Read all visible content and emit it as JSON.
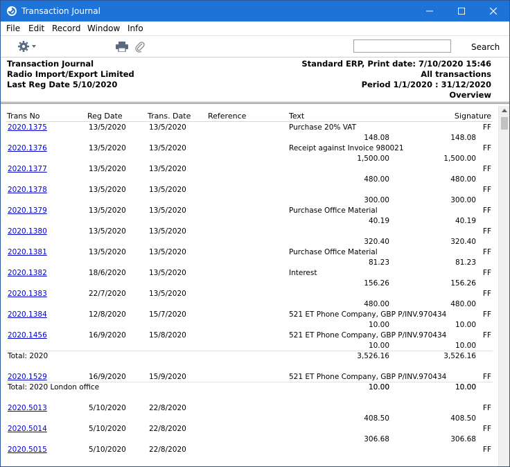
{
  "window": {
    "title": "Transaction Journal",
    "accent_color": "#1e73d8"
  },
  "menu": [
    "File",
    "Edit",
    "Record",
    "Window",
    "Info"
  ],
  "toolbar": {
    "search_label": "Search",
    "search_value": ""
  },
  "report": {
    "title": "Transaction Journal",
    "company": "Radio Import/Export Limited",
    "last_reg": "Last Reg Date  5/10/2020",
    "print_info": "Standard ERP, Print date: 7/10/2020 15:46",
    "selection": "All transactions",
    "period": "Period  1/1/2020 : 31/12/2020",
    "mode": "Overview"
  },
  "columns": {
    "trans_no": "Trans No",
    "reg_date": "Reg Date",
    "trans_date": "Trans. Date",
    "reference": "Reference",
    "text": "Text",
    "signature": "Signature"
  },
  "rows": [
    {
      "no": "2020.1375",
      "reg": "13/5/2020",
      "tdate": "13/5/2020",
      "text": "Purchase 20% VAT",
      "sig": "FF",
      "debit": "148.08",
      "credit": "148.08"
    },
    {
      "no": "2020.1376",
      "reg": "13/5/2020",
      "tdate": "13/5/2020",
      "text": "Receipt against Invoice 980021",
      "sig": "FF",
      "debit": "1,500.00",
      "credit": "1,500.00"
    },
    {
      "no": "2020.1377",
      "reg": "13/5/2020",
      "tdate": "13/5/2020",
      "text": "",
      "sig": "FF",
      "debit": "480.00",
      "credit": "480.00"
    },
    {
      "no": "2020.1378",
      "reg": "13/5/2020",
      "tdate": "13/5/2020",
      "text": "",
      "sig": "FF",
      "debit": "300.00",
      "credit": "300.00"
    },
    {
      "no": "2020.1379",
      "reg": "13/5/2020",
      "tdate": "13/5/2020",
      "text": "Purchase Office Material",
      "sig": "FF",
      "debit": "40.19",
      "credit": "40.19"
    },
    {
      "no": "2020.1380",
      "reg": "13/5/2020",
      "tdate": "13/5/2020",
      "text": "",
      "sig": "FF",
      "debit": "320.40",
      "credit": "320.40"
    },
    {
      "no": "2020.1381",
      "reg": "13/5/2020",
      "tdate": "13/5/2020",
      "text": "Purchase Office Material",
      "sig": "FF",
      "debit": "81.23",
      "credit": "81.23"
    },
    {
      "no": "2020.1382",
      "reg": "18/6/2020",
      "tdate": "13/5/2020",
      "text": "Interest",
      "sig": "FF",
      "debit": "156.26",
      "credit": "156.26"
    },
    {
      "no": "2020.1383",
      "reg": "22/7/2020",
      "tdate": "13/5/2020",
      "text": "",
      "sig": "FF",
      "debit": "480.00",
      "credit": "480.00"
    },
    {
      "no": "2020.1384",
      "reg": "12/8/2020",
      "tdate": "15/7/2020",
      "text": "521 ET Phone Company, GBP P/INV.970434",
      "sig": "FF",
      "debit": "10.00",
      "credit": "10.00"
    },
    {
      "no": "2020.1456",
      "reg": "16/9/2020",
      "tdate": "15/8/2020",
      "text": "521 ET Phone Company, GBP P/INV.970434",
      "sig": "FF",
      "debit": "10.00",
      "credit": "10.00"
    }
  ],
  "total1": {
    "label": "Total: 2020",
    "debit": "3,526.16",
    "credit": "3,526.16"
  },
  "rows2": [
    {
      "no": "2020.1529",
      "reg": "16/9/2020",
      "tdate": "15/9/2020",
      "text": "521 ET Phone Company, GBP P/INV.970434",
      "sig": "FF",
      "debit": "10.00",
      "credit": "10.00"
    }
  ],
  "total2": {
    "label": "Total: 2020 London office",
    "debit": "10.00",
    "credit": "10.00"
  },
  "rows3": [
    {
      "no": "2020.5013",
      "reg": "5/10/2020",
      "tdate": "22/8/2020",
      "text": "",
      "sig": "FF",
      "debit": "408.50",
      "credit": "408.50"
    },
    {
      "no": "2020.5014",
      "reg": "5/10/2020",
      "tdate": "22/8/2020",
      "text": "",
      "sig": "FF",
      "debit": "306.68",
      "credit": "306.68"
    },
    {
      "no": "2020.5015",
      "reg": "5/10/2020",
      "tdate": "22/8/2020",
      "text": "",
      "sig": "FF",
      "debit": "",
      "credit": ""
    }
  ]
}
